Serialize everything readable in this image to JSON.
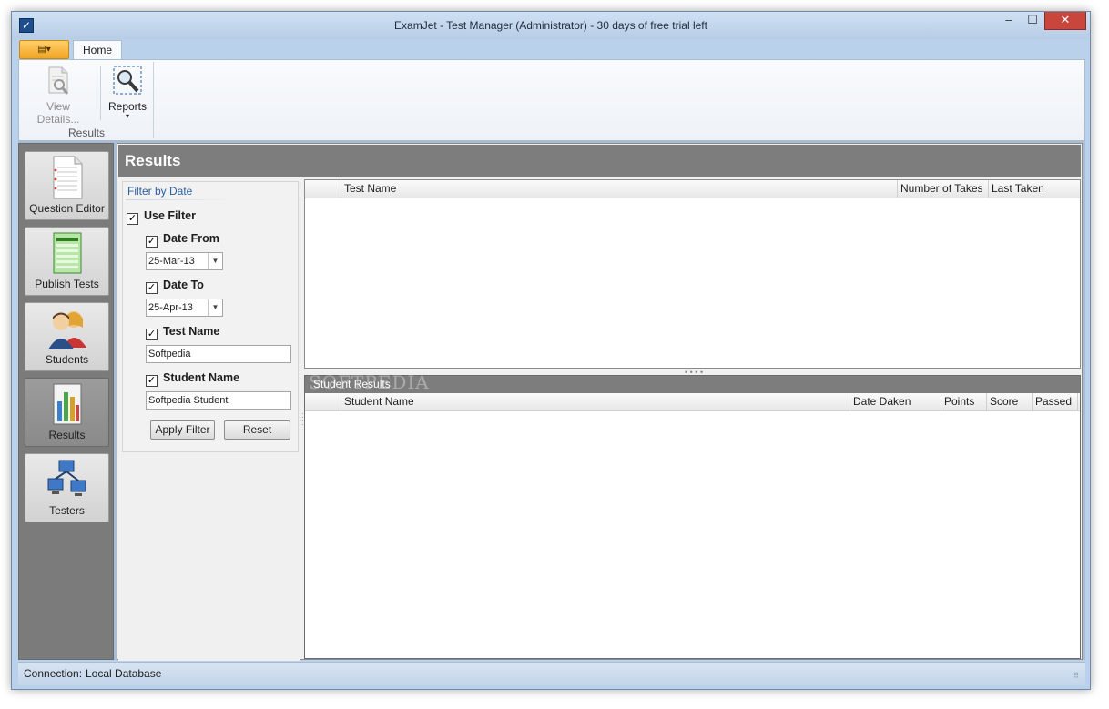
{
  "window": {
    "title": "ExamJet - Test Manager (Administrator) - 30 days of free trial left",
    "min_glyph": "–",
    "max_glyph": "☐",
    "close_glyph": "✕"
  },
  "ribbon": {
    "app_menu_glyph": "▤▾",
    "tabs": [
      {
        "label": "Home"
      }
    ],
    "buttons": {
      "view_details": "View Details...",
      "reports": "Reports"
    },
    "group_label": "Results",
    "reports_dropdown_glyph": "▾"
  },
  "nav": {
    "items": [
      {
        "label": "Question Editor",
        "icon": "document-icon"
      },
      {
        "label": "Publish Tests",
        "icon": "publish-sheet-icon"
      },
      {
        "label": "Students",
        "icon": "students-icon"
      },
      {
        "label": "Results",
        "icon": "results-chart-icon"
      },
      {
        "label": "Testers",
        "icon": "network-computers-icon"
      }
    ],
    "active": "Results"
  },
  "content": {
    "title": "Results"
  },
  "filter": {
    "caption": "Filter by Date",
    "use_filter": {
      "label": "Use Filter",
      "checked": true
    },
    "date_from": {
      "label": "Date From",
      "checked": true,
      "value": "25-Mar-13"
    },
    "date_to": {
      "label": "Date To",
      "checked": true,
      "value": "25-Apr-13"
    },
    "test_name": {
      "label": "Test Name",
      "checked": true,
      "value": "Softpedia"
    },
    "student_name": {
      "label": "Student Name",
      "checked": true,
      "value": "Softpedia Student"
    },
    "apply_label": "Apply Filter",
    "reset_label": "Reset",
    "check_glyph": "✓",
    "combo_arrow_glyph": "▼"
  },
  "tests_grid": {
    "columns": [
      "",
      "Test Name",
      "Number of Takes",
      "Last Taken"
    ],
    "rows": []
  },
  "student_results": {
    "title": "Student Results",
    "watermark": "SOFTPEDIA",
    "columns": [
      "",
      "Student Name",
      "Date Daken",
      "Points",
      "Score",
      "Passed"
    ],
    "rows": []
  },
  "status": {
    "connection_label": "Connection:",
    "connection_value": "Local Database"
  },
  "colors": {
    "nav_bg": "#7b7b7b",
    "header_bg": "#7d7d7d",
    "accent": "#2b5fa0",
    "close_button": "#c9463d",
    "app_menu": "#f0a522"
  }
}
